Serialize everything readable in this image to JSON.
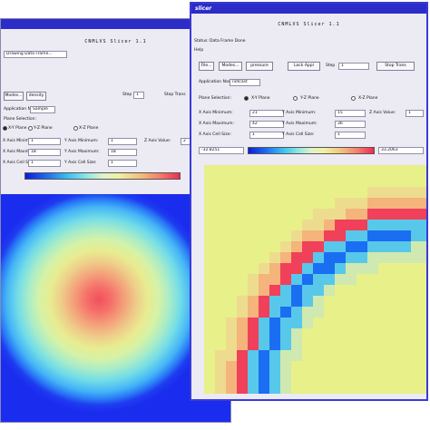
{
  "back_window": {
    "title": "",
    "app_title": "CNMLVS Slicer 1.1",
    "status": "Drawing Data Frame...",
    "buttons": [
      "Modes...",
      "density"
    ],
    "step_label": "Step",
    "step_value": "1",
    "stop_label": "Stop Trans",
    "app_name_label": "Application Name:",
    "app_name_value": "Sample",
    "plane_selection_label": "Plane Selection:",
    "planes": [
      "X-Y Plane",
      "Y-Z Plane",
      "X-Z Plane"
    ],
    "x_min_label": "X Axis Minimum:",
    "x_min_value": "1",
    "y_min_label": "Y Axis Minimum:",
    "y_min_value": "1",
    "z_val_label": "Z Axis Value:",
    "z_val_value": "2",
    "x_max_label": "X Axis Maximum:",
    "x_max_value": "18",
    "y_max_label": "Y Axis Maximum:",
    "y_max_value": "18",
    "x_cell_label": "X Axis Cell Size:",
    "x_cell_value": "1",
    "y_cell_label": "Y Axis Cell Size:",
    "y_cell_value": "1"
  },
  "front_window": {
    "title": "slicer",
    "app_title": "CNMLVS Slicer 1.1",
    "status_label": "Status:",
    "status_value": "Data Frame Done",
    "help_label": "Help",
    "file_button": "File...",
    "modes_button": "Modes...",
    "pressure_button": "pressure",
    "lock_button": "Lock Appl",
    "step_label": "Step",
    "step_value": "1",
    "stop_button": "Stop Trans",
    "app_name_label": "Application Name:",
    "app_name_value": "netcast",
    "plane_selection_label": "Plane Selection:",
    "planes": [
      "X-Y Plane",
      "Y-Z Plane",
      "X-Z Plane"
    ],
    "x_min_label": "X Axis Minimum:",
    "x_min_value": "21",
    "y_min_label": "Y Axis Minimum:",
    "y_min_value": "15",
    "z_val_label": "Z Axis Value:",
    "z_val_value": "1",
    "x_max_label": "X Axis Maximum:",
    "x_max_value": "42",
    "y_max_label": "Y Axis Maximum:",
    "y_max_value": "36",
    "x_cell_label": "X Axis Cell Size:",
    "x_cell_value": "1",
    "y_cell_label": "Y Axis Cell Size:",
    "y_cell_value": "1",
    "scale_min": "-32.8251",
    "scale_max": "33.2063"
  },
  "palette": {
    "background_field": "#e8f08a",
    "red_band": "#f0405a",
    "blue_band": "#1a6ef2",
    "cyan_band": "#58c8ea",
    "titlebar": "#2c2cc8"
  }
}
